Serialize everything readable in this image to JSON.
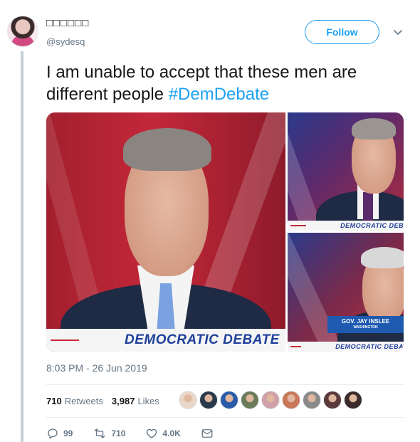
{
  "tweet": {
    "display_name": "□□□□□□",
    "handle": "@sydesq",
    "follow_label": "Follow",
    "text_plain": "I am unable to accept that these men are different people ",
    "hashtag": "#DemDebate",
    "timestamp": "8:03 PM - 26 Jun 2019"
  },
  "media": {
    "main_lower_third": "DEMOCRATIC DEBATE",
    "top_right_lower_third": "DEMOCRATIC DEB",
    "bottom_right_nameplate": {
      "name": "GOV. JAY INSLEE",
      "state": "WASHINGTON"
    },
    "bottom_right_lower_third": "DEMOCRATIC DEBA"
  },
  "stats": {
    "retweets_count": "710",
    "retweets_label": "Retweets",
    "likes_count": "3,987",
    "likes_label": "Likes"
  },
  "likers": [
    {
      "icon": "avatar-blonde",
      "color": "#e8d6c8"
    },
    {
      "icon": "avatar-landscape",
      "color": "#2b3a4a"
    },
    {
      "icon": "avatar-jersey",
      "color": "#2a5aa8"
    },
    {
      "icon": "avatar-person",
      "color": "#6a7a5a"
    },
    {
      "icon": "avatar-red",
      "color": "#d0a0a8"
    },
    {
      "icon": "avatar-smile",
      "color": "#c87858"
    },
    {
      "icon": "avatar-cat",
      "color": "#8a8a8a"
    },
    {
      "icon": "avatar-dark",
      "color": "#5a3a3a"
    },
    {
      "icon": "avatar-woman",
      "color": "#3a2a2a"
    }
  ],
  "actions": {
    "replies": "99",
    "retweets": "710",
    "likes": "4.0K"
  },
  "colors": {
    "accent": "#1da1f2",
    "text": "#14171a",
    "muted": "#657786"
  }
}
